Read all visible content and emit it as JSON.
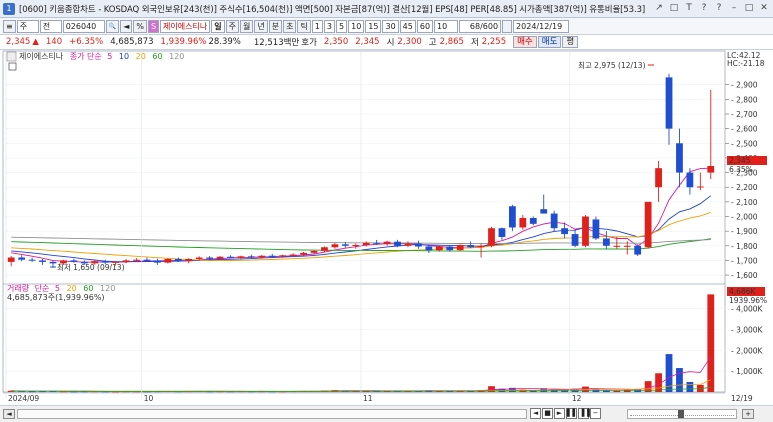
{
  "window": {
    "number": "1",
    "title": "[0600] 키움종합차트 - KOSDAQ 외국인보유[243(천)] 주식수[16,504(천)] 액면[500] 자본금[87(억)] 결산[12월] EPS[48] PER[48.85] 시가총액[387(억)] 유통비율[53.3]",
    "controls": [
      "↗",
      "□",
      "T",
      "?",
      "?",
      "–",
      "□",
      "✕"
    ]
  },
  "toolbar": {
    "menu_label": "≡",
    "market_value": "주",
    "range_value": "전",
    "code_value": "026040",
    "search_icon": "🔍",
    "prev_label": "◄",
    "percent_label": "%",
    "s_label": "S",
    "stock_name": "제이에스티나",
    "periods": [
      "일",
      "주",
      "월",
      "년",
      "분",
      "초",
      "틱"
    ],
    "minutes": [
      "1",
      "3",
      "5",
      "10",
      "15",
      "30",
      "45",
      "60"
    ],
    "interval_value": "10",
    "count_value": "68/600",
    "date_value": "2024/12/19"
  },
  "quote": {
    "price": "2,345",
    "arrow": "▲",
    "change": "140",
    "change_pct": "+6.35%",
    "volume": "4,685,873",
    "volume_pct": "1,939.96%",
    "turnover": "28.39%",
    "amount": "12,513백만",
    "hoga_label": "호가",
    "hoga": "2,350",
    "hoga2": "2,345",
    "open_label": "시",
    "open": "2,300",
    "high_label": "고",
    "high": "2,865",
    "low_label": "저",
    "low": "2,255",
    "buy_label": "매수",
    "sell_label": "매도",
    "flat_label": "평"
  },
  "price_panel": {
    "legend_name": "제이에스티나",
    "legend_ma_label": "종가 단순",
    "ma_periods": [
      "5",
      "10",
      "20",
      "60",
      "120"
    ],
    "ma_colors": [
      "#e0189a",
      "#2040d0",
      "#f0a000",
      "#22a022",
      "#909090"
    ],
    "lc_label": "LC:42.12",
    "hc_label": "HC:-21.18",
    "high_annotation": "최고 2,975 (12/13)",
    "low_annotation": "최저 1,650 (09/13)",
    "current_price_tag": "2,345",
    "current_pct_tag": "6.35%",
    "y_ticks": [
      "2,900",
      "2,800",
      "2,700",
      "2,600",
      "2,500",
      "2,400",
      "2,300",
      "2,200",
      "2,100",
      "2,000",
      "1,900",
      "1,800",
      "1,700",
      "1,600"
    ]
  },
  "volume_panel": {
    "legend_label": "거래량",
    "legend_ma_label": "단순",
    "ma_periods": [
      "5",
      "20",
      "60",
      "120"
    ],
    "value_label": "4,685,873주(1,939.96%)",
    "current_tag": "4,686K",
    "current_pct_tag": "1939.96%",
    "y_ticks": [
      "4,000K",
      "3,000K",
      "2,000K",
      "1,000K"
    ]
  },
  "x_axis": {
    "labels": [
      "2024/09",
      "10",
      "11",
      "12"
    ],
    "end_label": "12/19"
  },
  "scroll": {
    "controls": [
      "◄",
      "■",
      "►",
      "▌▌",
      "▐▐",
      "−"
    ]
  },
  "colors": {
    "up": "#e0201b",
    "down": "#1f4fd0"
  },
  "chart_data": {
    "type": "candlestick",
    "ohlc": [
      {
        "date": "09/09",
        "o": 1690,
        "h": 1730,
        "l": 1660,
        "c": 1720
      },
      {
        "date": "09/10",
        "o": 1720,
        "h": 1735,
        "l": 1695,
        "c": 1705
      },
      {
        "date": "09/11",
        "o": 1705,
        "h": 1720,
        "l": 1690,
        "c": 1700
      },
      {
        "date": "09/12",
        "o": 1700,
        "h": 1710,
        "l": 1670,
        "c": 1690
      },
      {
        "date": "09/13",
        "o": 1690,
        "h": 1700,
        "l": 1650,
        "c": 1680
      },
      {
        "date": "09/19",
        "o": 1680,
        "h": 1705,
        "l": 1670,
        "c": 1700
      },
      {
        "date": "09/20",
        "o": 1700,
        "h": 1712,
        "l": 1685,
        "c": 1690
      },
      {
        "date": "09/23",
        "o": 1690,
        "h": 1700,
        "l": 1670,
        "c": 1680
      },
      {
        "date": "09/24",
        "o": 1680,
        "h": 1700,
        "l": 1670,
        "c": 1695
      },
      {
        "date": "09/25",
        "o": 1695,
        "h": 1705,
        "l": 1675,
        "c": 1685
      },
      {
        "date": "09/26",
        "o": 1685,
        "h": 1695,
        "l": 1665,
        "c": 1690
      },
      {
        "date": "09/27",
        "o": 1690,
        "h": 1710,
        "l": 1680,
        "c": 1700
      },
      {
        "date": "09/30",
        "o": 1700,
        "h": 1715,
        "l": 1690,
        "c": 1705
      },
      {
        "date": "10/02",
        "o": 1705,
        "h": 1720,
        "l": 1690,
        "c": 1700
      },
      {
        "date": "10/04",
        "o": 1700,
        "h": 1712,
        "l": 1670,
        "c": 1685
      },
      {
        "date": "10/07",
        "o": 1685,
        "h": 1715,
        "l": 1680,
        "c": 1710
      },
      {
        "date": "10/08",
        "o": 1710,
        "h": 1720,
        "l": 1690,
        "c": 1695
      },
      {
        "date": "10/10",
        "o": 1695,
        "h": 1715,
        "l": 1680,
        "c": 1710
      },
      {
        "date": "10/11",
        "o": 1710,
        "h": 1728,
        "l": 1700,
        "c": 1720
      },
      {
        "date": "10/14",
        "o": 1720,
        "h": 1730,
        "l": 1705,
        "c": 1712
      },
      {
        "date": "10/15",
        "o": 1712,
        "h": 1730,
        "l": 1705,
        "c": 1725
      },
      {
        "date": "10/16",
        "o": 1725,
        "h": 1735,
        "l": 1715,
        "c": 1718
      },
      {
        "date": "10/17",
        "o": 1718,
        "h": 1732,
        "l": 1705,
        "c": 1728
      },
      {
        "date": "10/18",
        "o": 1728,
        "h": 1740,
        "l": 1715,
        "c": 1722
      },
      {
        "date": "10/21",
        "o": 1722,
        "h": 1738,
        "l": 1712,
        "c": 1732
      },
      {
        "date": "10/22",
        "o": 1732,
        "h": 1745,
        "l": 1720,
        "c": 1728
      },
      {
        "date": "10/23",
        "o": 1728,
        "h": 1740,
        "l": 1718,
        "c": 1735
      },
      {
        "date": "10/24",
        "o": 1735,
        "h": 1750,
        "l": 1725,
        "c": 1740
      },
      {
        "date": "10/25",
        "o": 1740,
        "h": 1758,
        "l": 1730,
        "c": 1752
      },
      {
        "date": "10/28",
        "o": 1752,
        "h": 1770,
        "l": 1745,
        "c": 1765
      },
      {
        "date": "10/29",
        "o": 1765,
        "h": 1795,
        "l": 1755,
        "c": 1790
      },
      {
        "date": "10/30",
        "o": 1790,
        "h": 1820,
        "l": 1780,
        "c": 1810
      },
      {
        "date": "10/31",
        "o": 1810,
        "h": 1825,
        "l": 1785,
        "c": 1800
      },
      {
        "date": "11/01",
        "o": 1800,
        "h": 1815,
        "l": 1780,
        "c": 1805
      },
      {
        "date": "11/04",
        "o": 1805,
        "h": 1830,
        "l": 1795,
        "c": 1820
      },
      {
        "date": "11/05",
        "o": 1820,
        "h": 1840,
        "l": 1805,
        "c": 1815
      },
      {
        "date": "11/06",
        "o": 1815,
        "h": 1835,
        "l": 1800,
        "c": 1828
      },
      {
        "date": "11/07",
        "o": 1828,
        "h": 1840,
        "l": 1790,
        "c": 1800
      },
      {
        "date": "11/08",
        "o": 1800,
        "h": 1830,
        "l": 1790,
        "c": 1815
      },
      {
        "date": "11/11",
        "o": 1815,
        "h": 1835,
        "l": 1780,
        "c": 1795
      },
      {
        "date": "11/12",
        "o": 1795,
        "h": 1810,
        "l": 1750,
        "c": 1770
      },
      {
        "date": "11/13",
        "o": 1770,
        "h": 1800,
        "l": 1760,
        "c": 1795
      },
      {
        "date": "11/14",
        "o": 1795,
        "h": 1805,
        "l": 1760,
        "c": 1770
      },
      {
        "date": "11/15",
        "o": 1770,
        "h": 1810,
        "l": 1765,
        "c": 1805
      },
      {
        "date": "11/18",
        "o": 1805,
        "h": 1830,
        "l": 1785,
        "c": 1790
      },
      {
        "date": "11/19",
        "o": 1790,
        "h": 1815,
        "l": 1720,
        "c": 1800
      },
      {
        "date": "11/20",
        "o": 1800,
        "h": 1930,
        "l": 1790,
        "c": 1920
      },
      {
        "date": "11/21",
        "o": 1920,
        "h": 1925,
        "l": 1840,
        "c": 1860
      },
      {
        "date": "11/22",
        "o": 2070,
        "h": 2080,
        "l": 1900,
        "c": 1925
      },
      {
        "date": "11/25",
        "o": 1925,
        "h": 2010,
        "l": 1910,
        "c": 1990
      },
      {
        "date": "11/26",
        "o": 1990,
        "h": 2000,
        "l": 1940,
        "c": 1950
      },
      {
        "date": "11/27",
        "o": 2050,
        "h": 2150,
        "l": 2020,
        "c": 2020
      },
      {
        "date": "11/28",
        "o": 2020,
        "h": 2040,
        "l": 1900,
        "c": 1920
      },
      {
        "date": "11/29",
        "o": 1920,
        "h": 1960,
        "l": 1850,
        "c": 1880
      },
      {
        "date": "12/02",
        "o": 1880,
        "h": 1905,
        "l": 1790,
        "c": 1800
      },
      {
        "date": "12/03",
        "o": 1800,
        "h": 2010,
        "l": 1790,
        "c": 2000
      },
      {
        "date": "12/04",
        "o": 1980,
        "h": 2000,
        "l": 1840,
        "c": 1850
      },
      {
        "date": "12/05",
        "o": 1850,
        "h": 1900,
        "l": 1780,
        "c": 1800
      },
      {
        "date": "12/06",
        "o": 1800,
        "h": 1860,
        "l": 1780,
        "c": 1800
      },
      {
        "date": "12/09",
        "o": 1800,
        "h": 1830,
        "l": 1740,
        "c": 1800
      },
      {
        "date": "12/10",
        "o": 1800,
        "h": 1810,
        "l": 1730,
        "c": 1740
      },
      {
        "date": "12/11",
        "o": 1790,
        "h": 2000,
        "l": 1780,
        "c": 2100
      },
      {
        "date": "12/12",
        "o": 2200,
        "h": 2380,
        "l": 2100,
        "c": 2330
      },
      {
        "date": "12/13",
        "o": 2950,
        "h": 2975,
        "l": 2490,
        "c": 2600
      },
      {
        "date": "12/16",
        "o": 2500,
        "h": 2600,
        "l": 2200,
        "c": 2300
      },
      {
        "date": "12/17",
        "o": 2300,
        "h": 2330,
        "l": 2150,
        "c": 2200
      },
      {
        "date": "12/18",
        "o": 2200,
        "h": 2300,
        "l": 2180,
        "c": 2205
      },
      {
        "date": "12/19",
        "o": 2300,
        "h": 2865,
        "l": 2255,
        "c": 2345
      }
    ],
    "volume_k": [
      60,
      40,
      30,
      35,
      45,
      30,
      25,
      28,
      30,
      25,
      22,
      30,
      28,
      26,
      32,
      40,
      30,
      35,
      38,
      30,
      32,
      28,
      35,
      30,
      33,
      30,
      28,
      35,
      40,
      45,
      70,
      90,
      60,
      55,
      65,
      50,
      55,
      70,
      48,
      60,
      80,
      55,
      60,
      65,
      50,
      90,
      280,
      160,
      200,
      120,
      90,
      180,
      140,
      110,
      160,
      260,
      130,
      90,
      80,
      110,
      150,
      520,
      900,
      1820,
      1150,
      480,
      340,
      4686
    ],
    "ylim_price": [
      1600,
      2975
    ],
    "ylim_volume": [
      0,
      4686
    ]
  }
}
